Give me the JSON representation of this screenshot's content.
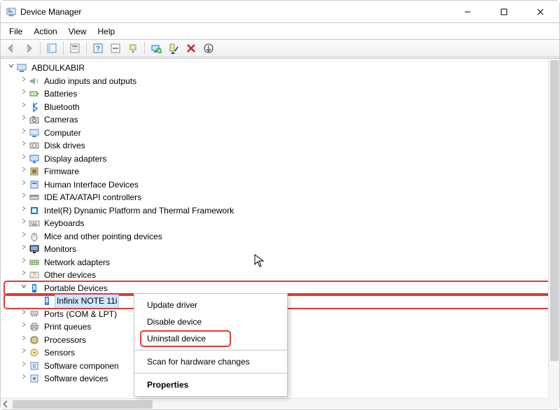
{
  "title": "Device Manager",
  "menubar": [
    "File",
    "Action",
    "View",
    "Help"
  ],
  "context_menu": {
    "update": "Update driver",
    "disable": "Disable device",
    "uninstall": "Uninstall device",
    "scan": "Scan for hardware changes",
    "properties": "Properties"
  },
  "root": "ABDULKABIR",
  "selected_device": "Infinix NOTE 11i",
  "categories": [
    {
      "label": "Audio inputs and outputs",
      "icon": "speaker"
    },
    {
      "label": "Batteries",
      "icon": "battery"
    },
    {
      "label": "Bluetooth",
      "icon": "bluetooth"
    },
    {
      "label": "Cameras",
      "icon": "camera"
    },
    {
      "label": "Computer",
      "icon": "computer"
    },
    {
      "label": "Disk drives",
      "icon": "disk"
    },
    {
      "label": "Display adapters",
      "icon": "display"
    },
    {
      "label": "Firmware",
      "icon": "firmware"
    },
    {
      "label": "Human Interface Devices",
      "icon": "hid"
    },
    {
      "label": "IDE ATA/ATAPI controllers",
      "icon": "ide"
    },
    {
      "label": "Intel(R) Dynamic Platform and Thermal Framework",
      "icon": "intel"
    },
    {
      "label": "Keyboards",
      "icon": "keyboard"
    },
    {
      "label": "Mice and other pointing devices",
      "icon": "mouse"
    },
    {
      "label": "Monitors",
      "icon": "monitor"
    },
    {
      "label": "Network adapters",
      "icon": "network"
    },
    {
      "label": "Other devices",
      "icon": "other"
    },
    {
      "label": "Portable Devices",
      "icon": "portable",
      "expanded": true,
      "highlight": true,
      "children": [
        {
          "label": "Infinix NOTE 11i",
          "icon": "phone",
          "selected": true
        }
      ]
    },
    {
      "label": "Ports (COM & LPT)",
      "icon": "ports"
    },
    {
      "label": "Print queues",
      "icon": "printer"
    },
    {
      "label": "Processors",
      "icon": "cpu"
    },
    {
      "label": "Sensors",
      "icon": "sensor"
    },
    {
      "label": "Software componen",
      "icon": "swc",
      "cut": true
    },
    {
      "label": "Software devices",
      "icon": "swd",
      "cut": true
    }
  ]
}
